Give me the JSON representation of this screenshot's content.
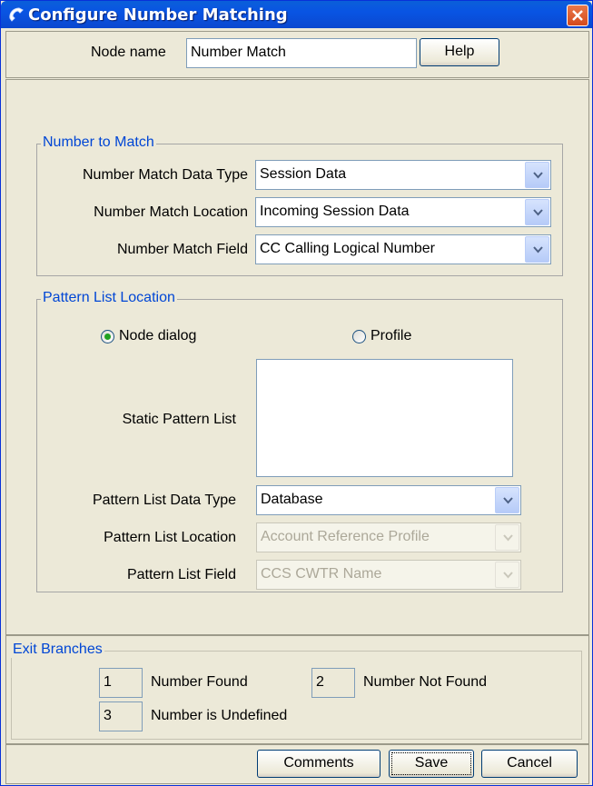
{
  "window": {
    "title": "Configure Number Matching"
  },
  "node": {
    "label": "Node name",
    "value": "Number Match",
    "help": "Help"
  },
  "number_to_match": {
    "legend": "Number to Match",
    "rows": [
      {
        "label": "Number Match Data Type",
        "value": "Session Data"
      },
      {
        "label": "Number Match Location",
        "value": "Incoming Session Data"
      },
      {
        "label": "Number Match Field",
        "value": "CC Calling Logical Number"
      }
    ]
  },
  "pattern_list": {
    "legend": "Pattern List Location",
    "radio_node": "Node dialog",
    "radio_profile": "Profile",
    "selected": "Node dialog",
    "static_label": "Static Pattern List",
    "static_value": "",
    "rows": [
      {
        "label": "Pattern List Data Type",
        "value": "Database",
        "enabled": true
      },
      {
        "label": "Pattern List Location",
        "value": "Account Reference Profile",
        "enabled": false
      },
      {
        "label": "Pattern List Field",
        "value": "CCS CWTR Name",
        "enabled": false
      }
    ]
  },
  "exits": {
    "legend": "Exit Branches",
    "items": [
      {
        "num": "1",
        "label": "Number Found"
      },
      {
        "num": "2",
        "label": "Number Not Found"
      },
      {
        "num": "3",
        "label": "Number is Undefined"
      }
    ]
  },
  "buttons": {
    "comments": "Comments",
    "save": "Save",
    "cancel": "Cancel"
  },
  "colors": {
    "title_bar": "#0a58d6",
    "legend_text": "#0046d5",
    "radio_selected": "#21a121",
    "close_button": "#e06a3a"
  }
}
